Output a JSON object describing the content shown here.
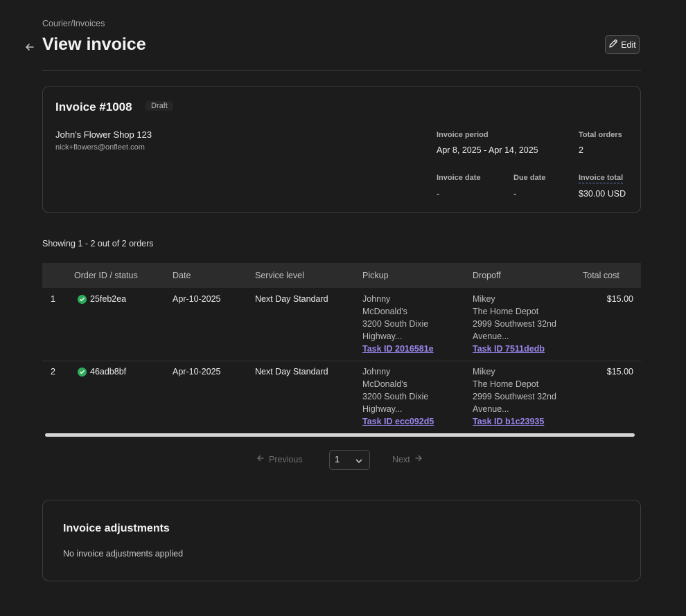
{
  "header": {
    "breadcrumb": "Courier/Invoices",
    "title": "View invoice",
    "edit_label": "Edit"
  },
  "invoice": {
    "title": "Invoice #1008",
    "status": "Draft",
    "shop_name": "John's Flower Shop 123",
    "email": "nick+flowers@onfleet.com",
    "period_label": "Invoice period",
    "period_value": "Apr 8, 2025 - Apr 14, 2025",
    "total_orders_label": "Total orders",
    "total_orders_value": "2",
    "invoice_date_label": "Invoice date",
    "invoice_date_value": "-",
    "due_date_label": "Due date",
    "due_date_value": "-",
    "invoice_total_label": "Invoice total",
    "invoice_total_value": "$30.00 USD"
  },
  "table": {
    "showing": "Showing 1 - 2 out of 2 orders",
    "columns": [
      "Order ID / status",
      "Date",
      "Service level",
      "Pickup",
      "Dropoff",
      "Total cost"
    ],
    "rows": [
      {
        "index": "1",
        "order_id": "25feb2ea",
        "date": "Apr-10-2025",
        "service": "Next Day Standard",
        "pickup_name": "Johnny",
        "pickup_place": "McDonald's",
        "pickup_addr1": "3200 South Dixie",
        "pickup_addr2": "Highway...",
        "pickup_task": "Task ID 2016581e",
        "dropoff_name": "Mikey",
        "dropoff_place": "The Home Depot",
        "dropoff_addr1": "2999 Southwest 32nd",
        "dropoff_addr2": "Avenue...",
        "dropoff_task": "Task ID 7511dedb",
        "cost": "$15.00"
      },
      {
        "index": "2",
        "order_id": "46adb8bf",
        "date": "Apr-10-2025",
        "service": "Next Day Standard",
        "pickup_name": "Johnny",
        "pickup_place": "McDonald's",
        "pickup_addr1": "3200 South Dixie",
        "pickup_addr2": "Highway...",
        "pickup_task": "Task ID ecc092d5",
        "dropoff_name": "Mikey",
        "dropoff_place": "The Home Depot",
        "dropoff_addr1": "2999 Southwest 32nd",
        "dropoff_addr2": "Avenue...",
        "dropoff_task": "Task ID b1c23935",
        "cost": "$15.00"
      }
    ]
  },
  "pagination": {
    "previous": "Previous",
    "page": "1",
    "next": "Next"
  },
  "adjustments": {
    "title": "Invoice adjustments",
    "empty_text": "No invoice adjustments applied"
  },
  "colors": {
    "background": "#1c1c1c",
    "status_ok": "#2eaa5a",
    "link": "#9b86ec"
  }
}
